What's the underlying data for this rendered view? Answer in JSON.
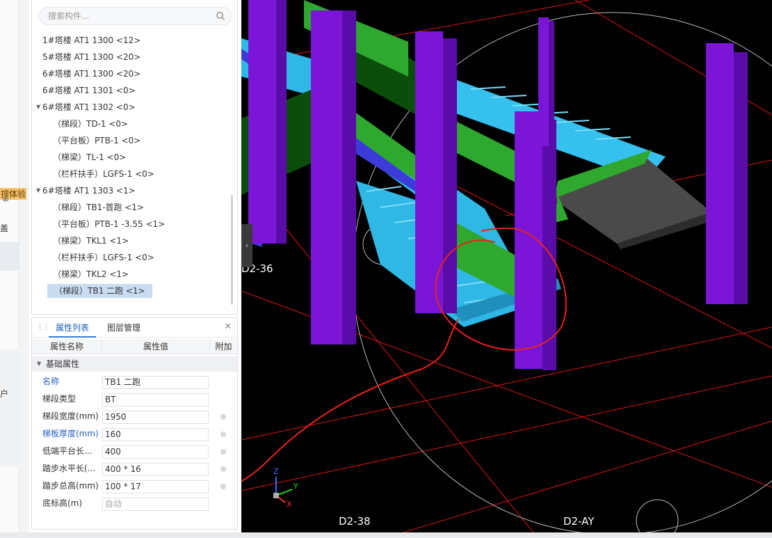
{
  "left_strip": {
    "badge": "捍体验",
    "label_a": "盖",
    "label_b": "户"
  },
  "search": {
    "placeholder": "搜索构件..."
  },
  "tree": {
    "items": [
      {
        "label": "1#塔楼 AT1 1300 <12>"
      },
      {
        "label": "5#塔楼 AT1 1300 <20>"
      },
      {
        "label": "6#塔楼 AT1 1300 <20>"
      },
      {
        "label": "6#塔楼 AT1 1301 <0>"
      },
      {
        "label": "6#塔楼 AT1 1302 <0>",
        "expanded": true
      },
      {
        "label": "（梯段）TD-1 <0>"
      },
      {
        "label": "（平台板）PTB-1 <0>"
      },
      {
        "label": "（梯梁）TL-1 <0>"
      },
      {
        "label": "（栏杆扶手）LGFS-1 <0>"
      },
      {
        "label": "6#塔楼 AT1 1303 <1>",
        "expanded": true
      },
      {
        "label": "（梯段）TB1-首跑 <1>"
      },
      {
        "label": "（平台板）PTB-1 -3.55 <1>"
      },
      {
        "label": "（梯梁）TKL1 <1>"
      },
      {
        "label": "（栏杆扶手）LGFS-1 <0>"
      },
      {
        "label": "（梯梁）TKL2 <1>"
      },
      {
        "label": "（梯段）TB1 二跑 <1>",
        "selected": true
      }
    ]
  },
  "props": {
    "tab_props": "属性列表",
    "tab_layers": "图层管理",
    "col_name": "属性名称",
    "col_value": "属性值",
    "col_extra": "附加",
    "group": "基础属性",
    "rows": [
      {
        "name": "名称",
        "value": "TB1 二跑"
      },
      {
        "name": "梯段类型",
        "value": "BT"
      },
      {
        "name": "梯段宽度(mm)",
        "value": "1950"
      },
      {
        "name": "梯板厚度(mm)",
        "value": "160"
      },
      {
        "name": "低端平台长...",
        "value": "400"
      },
      {
        "name": "踏步水平长(...",
        "value": "400 * 16"
      },
      {
        "name": "踏步总高(mm)",
        "value": "100 * 17"
      },
      {
        "name": "底标高(m)",
        "value": "自动"
      }
    ]
  },
  "viewport": {
    "axis_d2_36": "D2-36",
    "axis_d2_38": "D2-38",
    "axis_d2_ay": "D2-AY",
    "gizmo_x": "X",
    "gizmo_y": "Y",
    "gizmo_z": "Z"
  },
  "colors": {
    "column": "#7b16d9",
    "beam_green": "#2ea82e",
    "beam_dark": "#0b4d0b",
    "stair_blue": "#2fb8e6",
    "platform_gray": "#4a4a4a",
    "grid_red": "#e01515",
    "annotation_red": "#e8231a",
    "selected_bg": "#c9dcf2",
    "accent": "#3a7bd5"
  }
}
